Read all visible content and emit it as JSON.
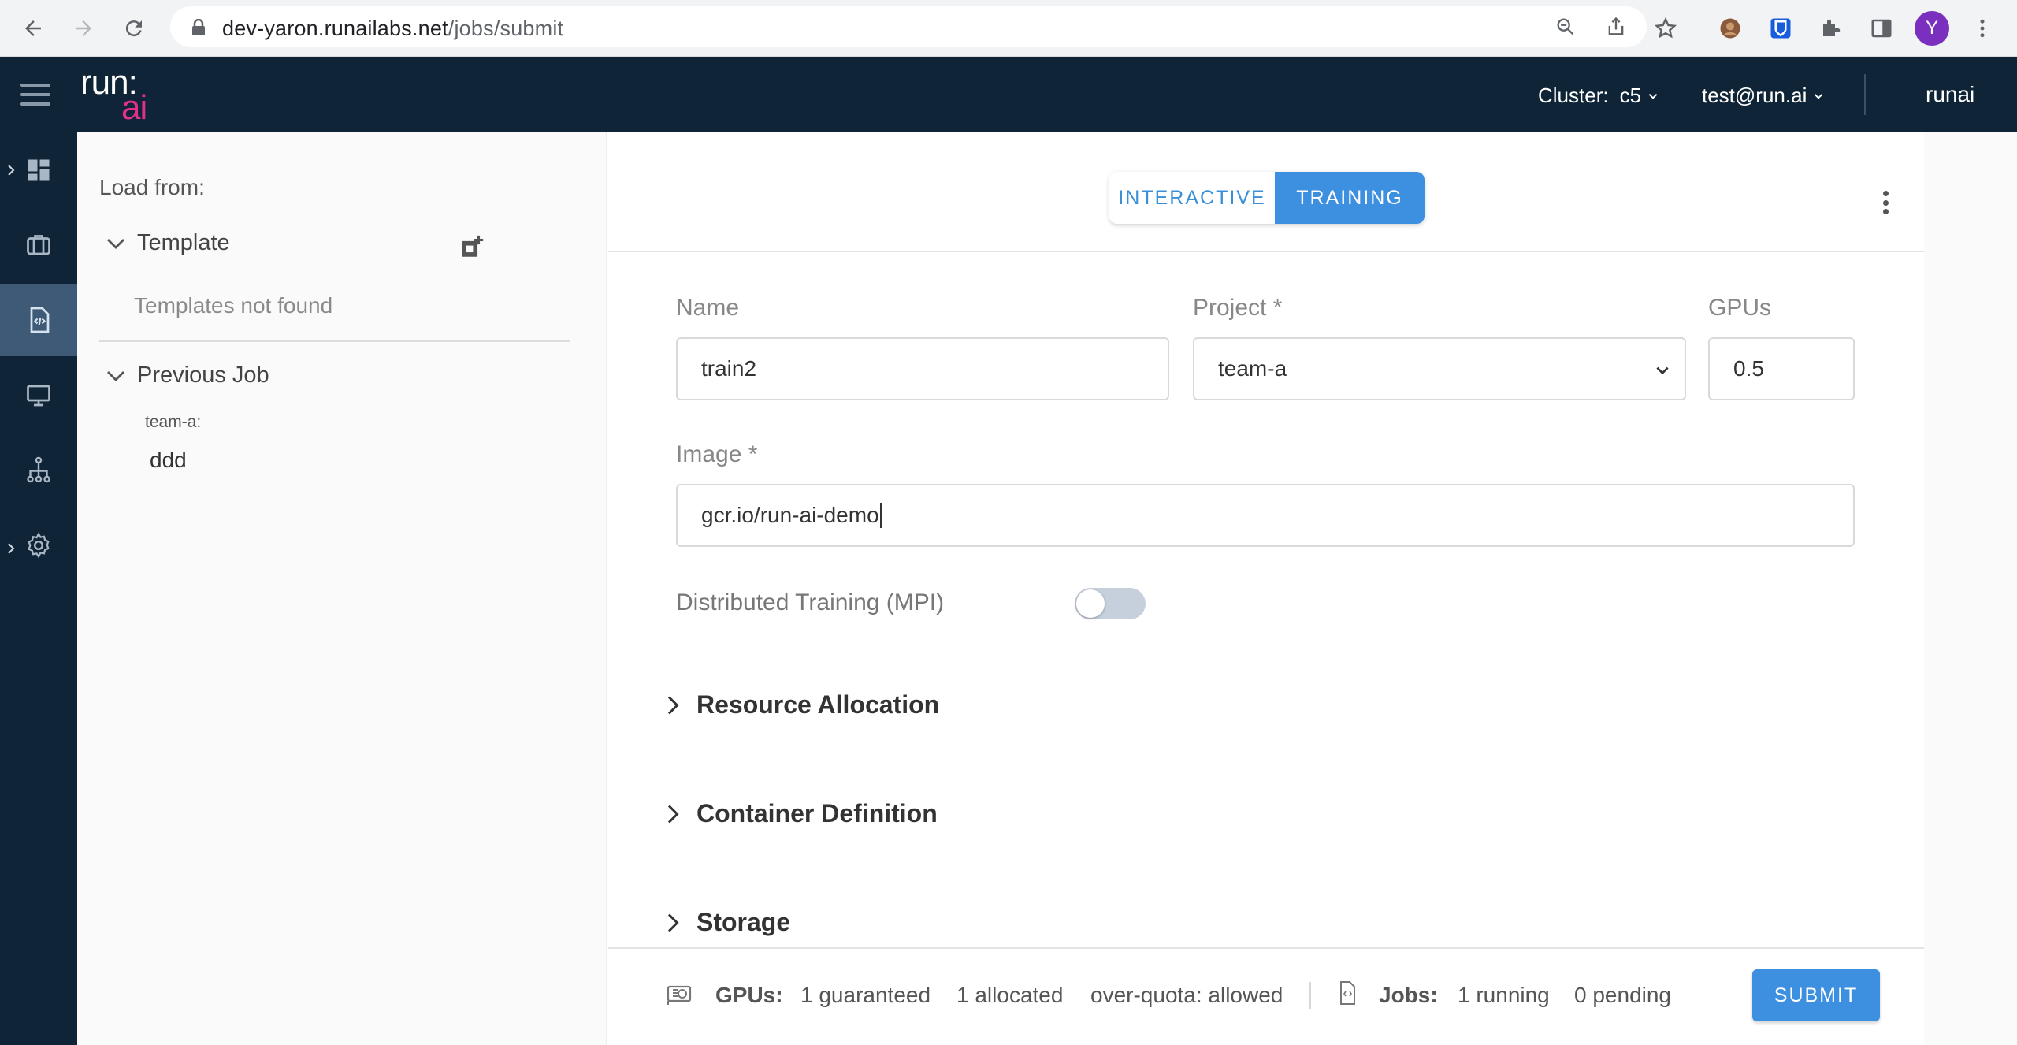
{
  "browser": {
    "url_host": "dev-yaron.runailabs.net",
    "url_path": "/jobs/submit",
    "profile_initial": "Y",
    "icons": [
      "back-icon",
      "forward-icon",
      "reload-icon",
      "lock-icon",
      "zoom-icon",
      "share-icon",
      "star-icon",
      "extension-avatar-icon",
      "bitwarden-icon",
      "puzzle-icon",
      "sidepanel-icon",
      "kebab-menu-icon"
    ]
  },
  "header": {
    "logo_top": "run:",
    "logo_bottom": "ai",
    "cluster_label": "Cluster:",
    "cluster_value": "c5",
    "user": "test@run.ai",
    "tenant": "runai"
  },
  "rail": {
    "items": [
      "dashboard-icon",
      "jobs-icon",
      "submit-job-icon",
      "nodes-icon",
      "departments-icon",
      "settings-icon"
    ],
    "active_index": 2
  },
  "load_panel": {
    "title": "Load from:",
    "template_section": "Template",
    "template_empty": "Templates not found",
    "previous_section": "Previous Job",
    "previous_project": "team-a:",
    "previous_job": "ddd"
  },
  "form": {
    "mode_interactive": "INTERACTIVE",
    "mode_training": "TRAINING",
    "selected_mode": "TRAINING",
    "name_label": "Name",
    "name_value": "train2",
    "project_label": "Project *",
    "project_value": "team-a",
    "gpus_label": "GPUs",
    "gpus_value": "0.5",
    "image_label": "Image *",
    "image_value": "gcr.io/run-ai-demo",
    "distributed_label": "Distributed Training (MPI)",
    "distributed_enabled": false,
    "sections": [
      "Resource Allocation",
      "Container Definition",
      "Storage"
    ]
  },
  "footer": {
    "gpus_label": "GPUs:",
    "gpus_guaranteed": "1 guaranteed",
    "gpus_allocated": "1 allocated",
    "over_quota": "over-quota: allowed",
    "jobs_label": "Jobs:",
    "jobs_running": "1 running",
    "jobs_pending": "0 pending",
    "submit_label": "SUBMIT"
  },
  "colors": {
    "header_bg": "#0f2537",
    "accent": "#3d8fe0",
    "logo_accent": "#e0318b"
  }
}
